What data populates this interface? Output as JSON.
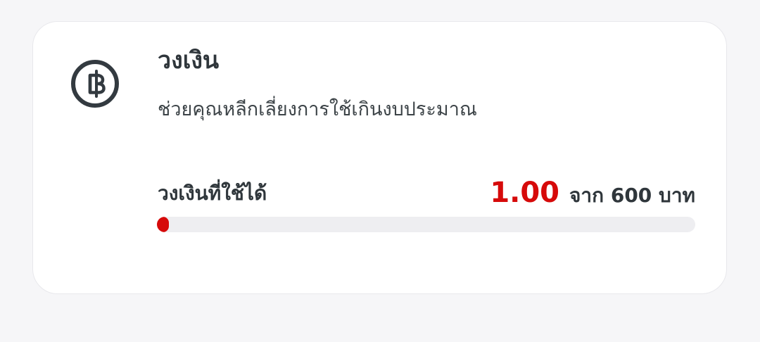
{
  "card": {
    "icon": "baht-coin-icon",
    "title": "วงเงิน",
    "subtitle": "ช่วยคุณหลีกเลี่ยงการใช้เกินงบประมาณ"
  },
  "limit": {
    "label": "วงเงินที่ใช้ได้",
    "used_amount": "1.00",
    "of_text": "จาก 600 บาท",
    "used_value": 1,
    "total_value": 600
  },
  "colors": {
    "accent": "#d60a0a",
    "track": "#eeeef1",
    "text": "#2f363b",
    "background": "#f6f6f8",
    "card": "#ffffff"
  }
}
